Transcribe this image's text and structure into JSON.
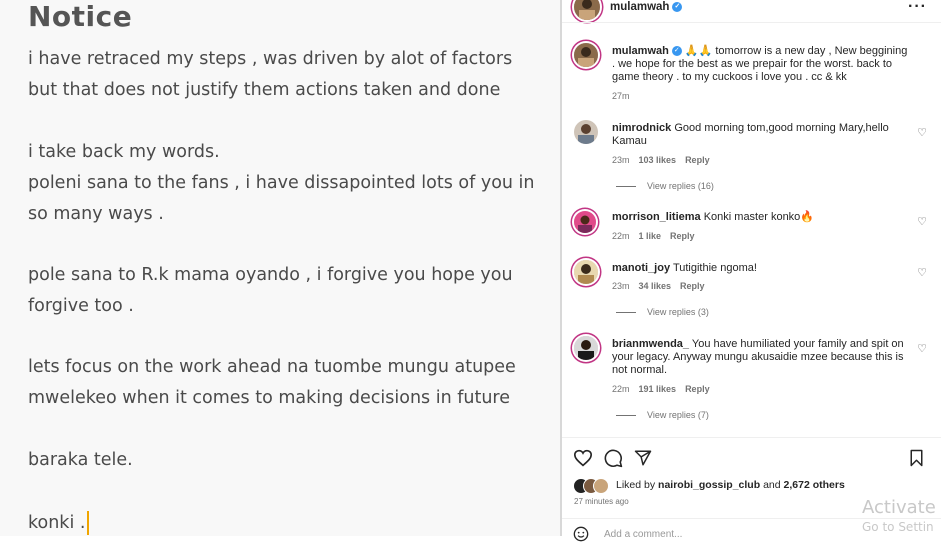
{
  "notice": {
    "title": "Notice",
    "lines": [
      "i have retraced my steps , was driven by alot of factors",
      "but that does not justify them actions taken and done",
      "i take back my words.",
      "poleni sana to the fans , i have dissapointed lots of you in",
      "so many ways .",
      "pole sana to R.k mama oyando , i forgive you hope you",
      "forgive too .",
      "lets focus on the work ahead na tuombe mungu atupee",
      "mwelekeo when it comes to making decisions in future",
      "baraka tele.",
      "konki ."
    ]
  },
  "post": {
    "username": "mulamwah",
    "caption_user": "mulamwah",
    "caption_text": "🙏🙏 tomorrow is a new day , New beggining . we hope for the best as we prepair for the worst. back to game theory . to my cuckoos i love you . cc & kk",
    "caption_time": "27m"
  },
  "comments": [
    {
      "user": "nimrodnick",
      "text": "Good morning tom,good morning Mary,hello Kamau",
      "time": "23m",
      "likes": "103 likes",
      "reply": "Reply",
      "view_replies": "View replies (16)"
    },
    {
      "user": "morrison_litiema",
      "text": "Konki master konko🔥",
      "time": "22m",
      "likes": "1 like",
      "reply": "Reply",
      "view_replies": ""
    },
    {
      "user": "manoti_joy",
      "text": "Tutigithie ngoma!",
      "time": "23m",
      "likes": "34 likes",
      "reply": "Reply",
      "view_replies": "View replies (3)"
    },
    {
      "user": "brianmwenda_",
      "text": "You have humiliated your family and spit on your legacy. Anyway mungu akusaidie mzee because this is not normal.",
      "time": "22m",
      "likes": "191 likes",
      "reply": "Reply",
      "view_replies": "View replies (7)"
    }
  ],
  "likes": {
    "prefix": "Liked by",
    "user": "nairobi_gossip_club",
    "and": "and",
    "others": "2,672 others"
  },
  "posted_ago": "27 minutes ago",
  "add_comment_placeholder": "Add a comment...",
  "watermark": {
    "line1": "Activate W",
    "line2": "Go to Settin"
  },
  "icons": [
    "heart-icon",
    "comment-icon",
    "share-icon",
    "bookmark-icon",
    "more-icon",
    "verified-icon",
    "emoji-icon"
  ],
  "colors": {
    "verified": "#3897f0",
    "cursor": "#f0a500",
    "story_ring": "#c13584"
  }
}
